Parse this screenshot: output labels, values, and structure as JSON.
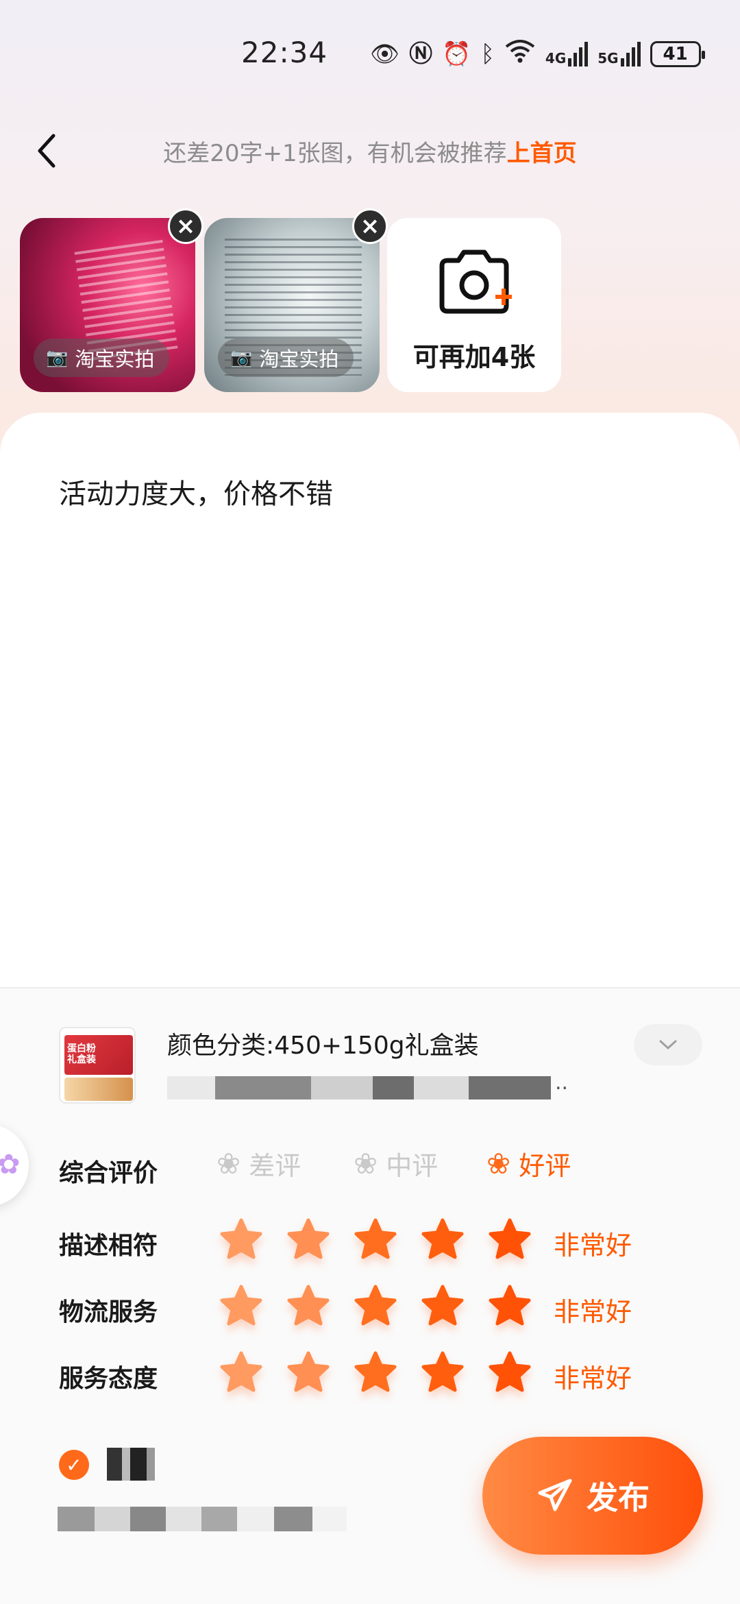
{
  "status_bar": {
    "time": "22:34",
    "icons": [
      "eye-icon",
      "nfc-icon",
      "alarm-icon",
      "bluetooth-icon",
      "wifi-icon",
      "signal-4g-icon",
      "signal-5g-icon"
    ],
    "sig1": "4G",
    "sig2": "5G",
    "battery": "41"
  },
  "header": {
    "hint_prefix": "还差20字+1张图，有机会被推荐",
    "hint_highlight": "上首页"
  },
  "photos": {
    "items": [
      {
        "badge": "淘宝实拍"
      },
      {
        "badge": "淘宝实拍"
      }
    ],
    "add_label": "可再加4张"
  },
  "review": {
    "text": "活动力度大，价格不错"
  },
  "product": {
    "variant": "颜色分类:450+150g礼盒装",
    "thumb_title": "蛋白粉\n礼盒装",
    "ellipsis": ".."
  },
  "ratings": {
    "overall_label": "综合评价",
    "options": [
      {
        "label": "差评",
        "selected": false
      },
      {
        "label": "中评",
        "selected": false
      },
      {
        "label": "好评",
        "selected": true
      }
    ],
    "rows": [
      {
        "label": "描述相符",
        "stars": 5,
        "text": "非常好"
      },
      {
        "label": "物流服务",
        "stars": 5,
        "text": "非常好"
      },
      {
        "label": "服务态度",
        "stars": 5,
        "text": "非常好"
      }
    ]
  },
  "footer": {
    "publish_label": "发布"
  },
  "colors": {
    "accent": "#ff5a00",
    "star_light": "#ff9a5c",
    "star_dark": "#ff5a0a"
  }
}
